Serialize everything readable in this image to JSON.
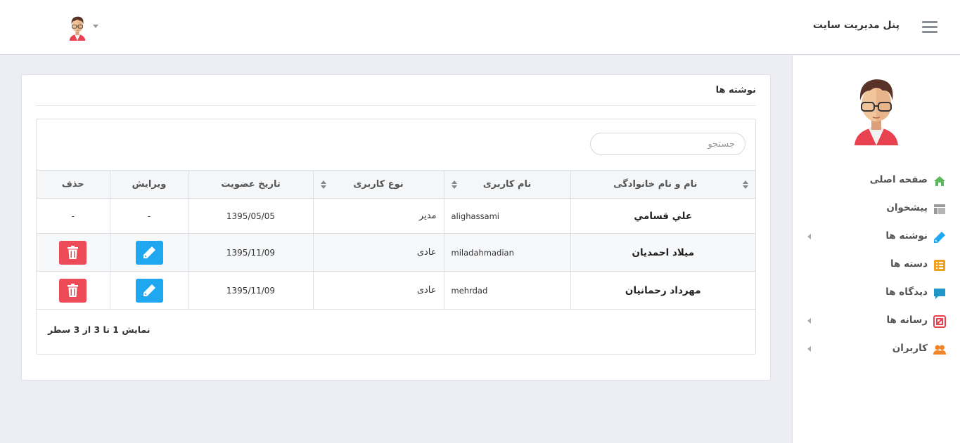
{
  "header": {
    "brand": "پنل مدیریت سایت",
    "menu_icon": "hamburger-icon",
    "user_avatar": "user-avatar-icon"
  },
  "sidebar": {
    "items": [
      {
        "label": "صفحه اصلی",
        "icon": "home-icon",
        "color": "#5cb85c",
        "has_submenu": false
      },
      {
        "label": "پیشخوان",
        "icon": "dashboard-icon",
        "color": "#999999",
        "has_submenu": false
      },
      {
        "label": "نوشته ها",
        "icon": "pencil-icon",
        "color": "#1fa8f0",
        "has_submenu": true
      },
      {
        "label": "دسته ها",
        "icon": "list-icon",
        "color": "#f0a020",
        "has_submenu": false
      },
      {
        "label": "دیدگاه ها",
        "icon": "comment-icon",
        "color": "#2196c9",
        "has_submenu": false
      },
      {
        "label": "رسانه ها",
        "icon": "media-icon",
        "color": "#e8414f",
        "has_submenu": true
      },
      {
        "label": "کاربران",
        "icon": "users-icon",
        "color": "#f0862a",
        "has_submenu": true
      }
    ]
  },
  "panel": {
    "title": "نوشته ها",
    "search_placeholder": "جستجو",
    "columns": [
      "نام و نام خانوادگی",
      "نام کاربری",
      "نوع کاربری",
      "تاریخ عضویت",
      "ویرایش",
      "حذف"
    ],
    "rows": [
      {
        "name": "علي قسامي",
        "username": "alighassami",
        "role": "مدیر",
        "date": "1395/05/05",
        "edit": "-",
        "delete": "-"
      },
      {
        "name": "میلاد احمدیان",
        "username": "miladahmadian",
        "role": "عادی",
        "date": "1395/11/09",
        "edit": "pencil-icon",
        "delete": "trash-icon"
      },
      {
        "name": "مهرداد رحمانیان",
        "username": "mehrdad",
        "role": "عادی",
        "date": "1395/11/09",
        "edit": "pencil-icon",
        "delete": "trash-icon"
      }
    ],
    "info": "نمایش 1 تا 3 از 3 سطر"
  },
  "colors": {
    "edit_button": "#1fa8f0",
    "delete_button": "#ee4b58"
  }
}
